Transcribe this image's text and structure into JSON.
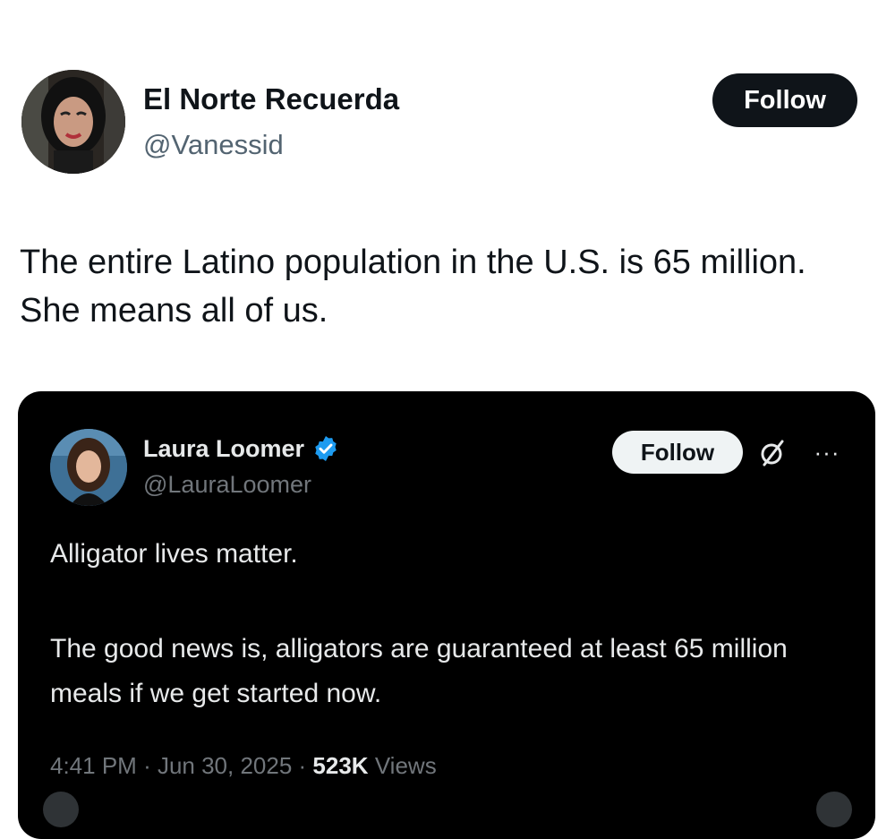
{
  "outer_post": {
    "display_name": "El Norte Recuerda",
    "handle": "@Vanessid",
    "follow_label": "Follow",
    "text": "The entire Latino population in the U.S. is 65 million. She means all of us."
  },
  "quoted_post": {
    "display_name": "Laura Loomer",
    "verified": true,
    "handle": "@LauraLoomer",
    "follow_label": "Follow",
    "more_label": "···",
    "text_line_1": "Alligator lives matter.",
    "text_line_2": "The good news is, alligators are guaranteed at least 65 million meals if we get started now.",
    "time": "4:41 PM",
    "date": "Jun 30, 2025",
    "separator": "·",
    "views_count": "523K",
    "views_label": "Views"
  },
  "colors": {
    "text_primary": "#0f1419",
    "text_secondary": "#536471",
    "card_background": "#000000",
    "verified_blue": "#1d9bf0"
  },
  "icons": {
    "verified": "verified-badge-icon",
    "grok": "grok-icon",
    "more": "more-options-icon"
  }
}
